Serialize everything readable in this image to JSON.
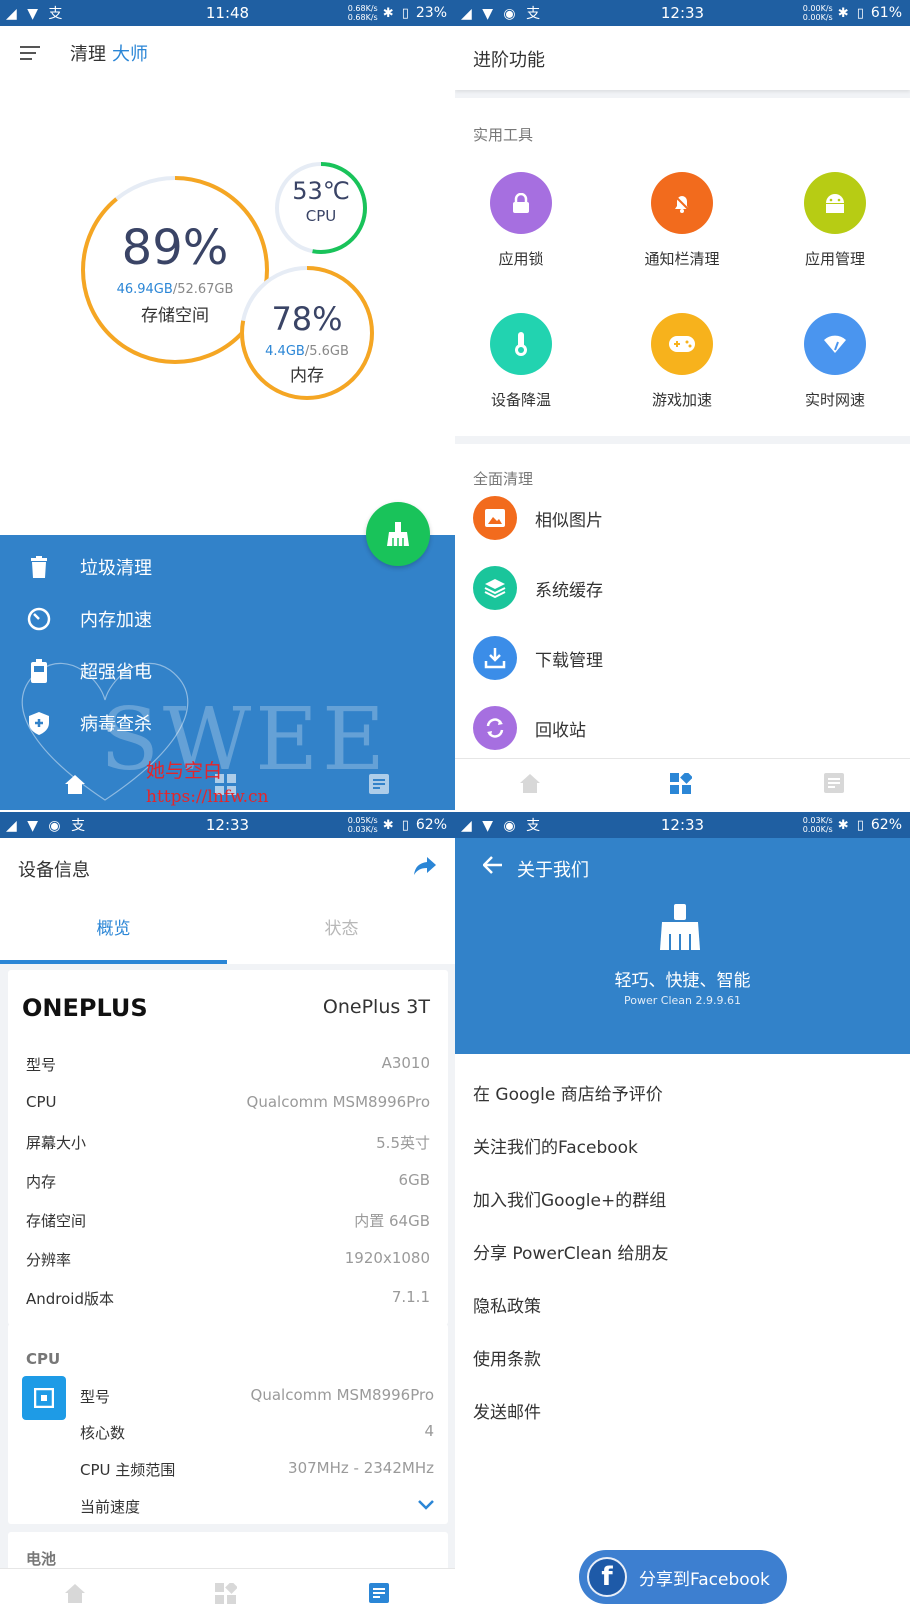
{
  "panel1": {
    "statusbar": {
      "time": "11:48",
      "speed_up": "0.68K/s",
      "speed_down": "0.68K/s",
      "battery": "23%"
    },
    "header": {
      "title": "清理",
      "title_accent": "大师"
    },
    "storage": {
      "percent": "89%",
      "used": "46.94GB",
      "total": "/52.67GB",
      "label": "存储空间",
      "level": 0.89
    },
    "cpu": {
      "temp": "53℃",
      "label": "CPU",
      "level": 0.53
    },
    "memory": {
      "percent": "78%",
      "used": "4.4GB",
      "total": "/5.6GB",
      "label": "内存",
      "level": 0.78
    },
    "menu": [
      {
        "label": "垃圾清理",
        "icon": "trash-icon"
      },
      {
        "label": "内存加速",
        "icon": "speedometer-icon"
      },
      {
        "label": "超强省电",
        "icon": "battery-icon"
      },
      {
        "label": "病毒查杀",
        "icon": "shield-plus-icon"
      }
    ],
    "watermark": {
      "text": "SWEE",
      "line1": "她与空白",
      "line2": "https://lnfw.cn"
    }
  },
  "panel2": {
    "statusbar": {
      "time": "12:33",
      "speed_up": "0.00K/s",
      "speed_down": "0.00K/s",
      "battery": "61%"
    },
    "header": {
      "title": "进阶功能"
    },
    "tools_title": "实用工具",
    "tools": [
      {
        "label": "应用锁",
        "icon": "lock-icon",
        "color": "#a66fe0"
      },
      {
        "label": "通知栏清理",
        "icon": "bell-off-icon",
        "color": "#f26b1d"
      },
      {
        "label": "应用管理",
        "icon": "android-icon",
        "color": "#b7cc14"
      },
      {
        "label": "设备降温",
        "icon": "thermometer-icon",
        "color": "#22d3b0"
      },
      {
        "label": "游戏加速",
        "icon": "gamepad-icon",
        "color": "#f7b21c"
      },
      {
        "label": "实时网速",
        "icon": "wifi-icon",
        "color": "#4a95ef"
      }
    ],
    "clean_title": "全面清理",
    "clean_items": [
      {
        "label": "相似图片",
        "icon": "photo-icon",
        "color": "#f26b1d"
      },
      {
        "label": "系统缓存",
        "icon": "layers-icon",
        "color": "#1ac59b"
      },
      {
        "label": "下载管理",
        "icon": "download-icon",
        "color": "#3b8de8"
      },
      {
        "label": "回收站",
        "icon": "recycle-icon",
        "color": "#a66fe0"
      }
    ]
  },
  "panel3": {
    "statusbar": {
      "time": "12:33",
      "speed_up": "0.05K/s",
      "speed_down": "0.03K/s",
      "battery": "62%"
    },
    "header": {
      "title": "设备信息"
    },
    "tabs": [
      "概览",
      "状态"
    ],
    "brand": "ONEPLUS",
    "model": "OnePlus 3T",
    "specs": [
      {
        "k": "型号",
        "v": "A3010"
      },
      {
        "k": "CPU",
        "v": "Qualcomm MSM8996Pro"
      },
      {
        "k": "屏幕大小",
        "v": "5.5英寸"
      },
      {
        "k": "内存",
        "v": "6GB"
      },
      {
        "k": "存储空间",
        "v": "内置 64GB"
      },
      {
        "k": "分辨率",
        "v": "1920x1080"
      },
      {
        "k": "Android版本",
        "v": "7.1.1"
      }
    ],
    "cpu_title": "CPU",
    "cpu_specs": [
      {
        "k": "型号",
        "v": "Qualcomm MSM8996Pro"
      },
      {
        "k": "核心数",
        "v": "4"
      },
      {
        "k": "CPU 主频范围",
        "v": "307MHz - 2342MHz"
      },
      {
        "k": "当前速度",
        "v": ""
      }
    ],
    "battery_title": "电池"
  },
  "panel4": {
    "statusbar": {
      "time": "12:33",
      "speed_up": "0.03K/s",
      "speed_down": "0.00K/s",
      "battery": "62%"
    },
    "header": {
      "title": "关于我们"
    },
    "slogan": "轻巧、快捷、智能",
    "version": "Power Clean 2.9.9.61",
    "links": [
      "在 Google 商店给予评价",
      "关注我们的Facebook",
      "加入我们Google+的群组",
      "分享 PowerClean 给朋友",
      "隐私政策",
      "使用条款",
      "发送邮件"
    ],
    "share_button": "分享到Facebook",
    "share_icon_letter": "f"
  }
}
